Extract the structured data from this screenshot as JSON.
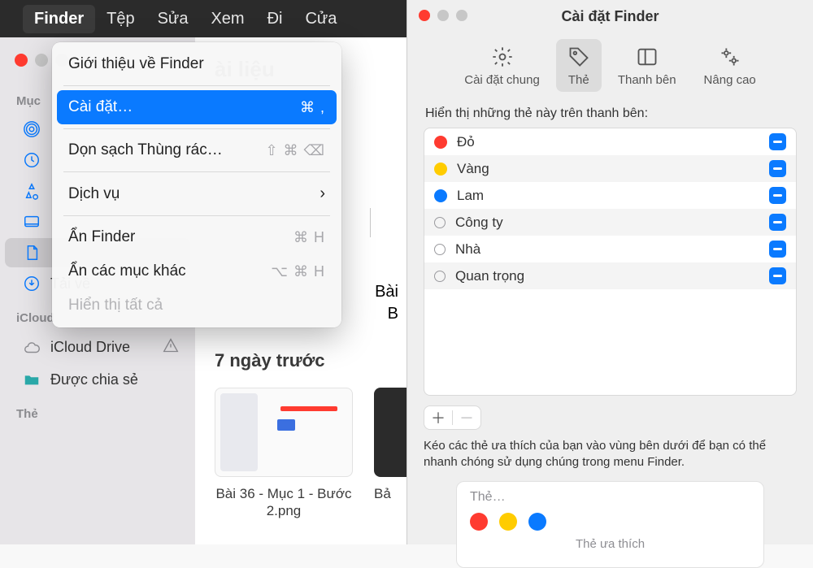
{
  "menubar": {
    "items": [
      "Finder",
      "Tệp",
      "Sửa",
      "Xem",
      "Đi",
      "Cửa"
    ],
    "active_index": 0
  },
  "dropdown": {
    "about": "Giới thiệu về Finder",
    "settings": "Cài đặt…",
    "settings_shortcut": "⌘ ,",
    "empty_trash": "Dọn sạch Thùng rác…",
    "empty_trash_shortcut": "⇧ ⌘ ⌫",
    "services": "Dịch vụ",
    "hide_finder": "Ẩn Finder",
    "hide_finder_shortcut": "⌘ H",
    "hide_others": "Ẩn các mục khác",
    "hide_others_shortcut": "⌥ ⌘ H",
    "show_all": "Hiển thị tất cả"
  },
  "finder": {
    "title_partial": "ài liệu",
    "sidebar": {
      "section_favorites": "Mục",
      "items": [
        {
          "label": ""
        },
        {
          "label": ""
        },
        {
          "label": ""
        },
        {
          "label": ""
        },
        {
          "label": ""
        },
        {
          "label": "Tải về"
        }
      ],
      "section_icloud": "iCloud",
      "icloud_drive": "iCloud Drive",
      "shared": "Được chia sẻ",
      "section_tags": "Thẻ"
    },
    "section_7days": "7 ngày trước",
    "file1_partial_top": "Bài",
    "file1_partial_bottom": "B",
    "file2": "Bài 36 - Mục 1 - Bước 2.png",
    "file3_partial": "Bả"
  },
  "prefs": {
    "window_title": "Cài đặt Finder",
    "tabs": {
      "general": "Cài đặt chung",
      "tags": "Thẻ",
      "sidebar": "Thanh bên",
      "advanced": "Nâng cao",
      "selected_index": 1
    },
    "caption": "Hiển thị những thẻ này trên thanh bên:",
    "tags": [
      {
        "label": "Đỏ",
        "color": "#ff3b30",
        "filled": true
      },
      {
        "label": "Vàng",
        "color": "#ffcc00",
        "filled": true
      },
      {
        "label": "Lam",
        "color": "#0a7aff",
        "filled": true
      },
      {
        "label": "Công ty",
        "color": "",
        "filled": false
      },
      {
        "label": "Nhà",
        "color": "",
        "filled": false
      },
      {
        "label": "Quan trọng",
        "color": "",
        "filled": false
      }
    ],
    "hint": "Kéo các thẻ ưa thích của bạn vào vùng bên dưới để bạn có thể nhanh chóng sử dụng chúng trong menu Finder.",
    "fav_title": "Thẻ…",
    "fav_caption": "Thẻ ưa thích",
    "fav_dots": [
      "#ff3b30",
      "#ffcc00",
      "#0a7aff"
    ]
  }
}
